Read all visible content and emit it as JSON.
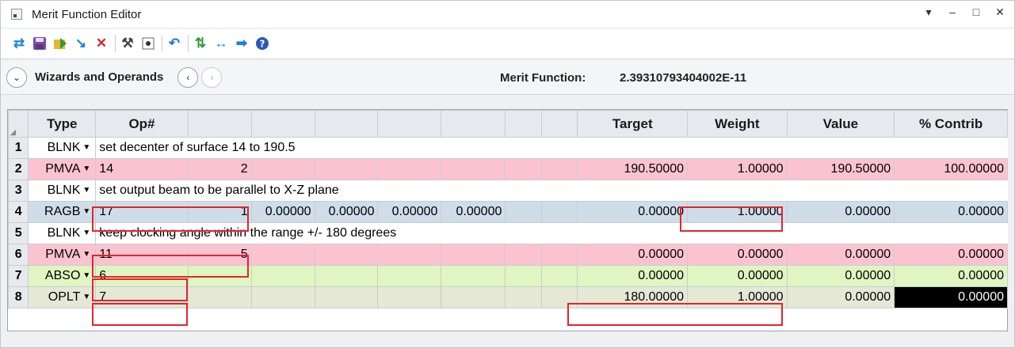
{
  "window": {
    "title": "Merit Function Editor",
    "controls": [
      "▾",
      "–",
      "□",
      "✕"
    ]
  },
  "toolbar": {
    "icons": [
      "refresh-icon",
      "save-icon",
      "load-icon",
      "insert-icon",
      "delete-icon",
      "wizard-icon",
      "options-icon",
      "undo-icon",
      "optimize-icon",
      "scroll-icon",
      "go-icon",
      "help-icon"
    ]
  },
  "wizard": {
    "label": "Wizards and Operands",
    "merit_label": "Merit Function:",
    "merit_value": "2.39310793404002E-11"
  },
  "grid": {
    "columns": [
      "Type",
      "Op#",
      "",
      "",
      "",
      "",
      "",
      "",
      "",
      "Target",
      "Weight",
      "Value",
      "% Contrib"
    ],
    "rows": [
      {
        "num": "1",
        "type": "BLNK",
        "style": "blank",
        "comment": "set decenter of surface 14 to 190.5"
      },
      {
        "num": "2",
        "type": "PMVA",
        "style": "pink",
        "op": "14",
        "int2": "2",
        "p": [
          "",
          "",
          "",
          ""
        ],
        "target": "190.50000",
        "weight": "1.00000",
        "value": "190.50000",
        "contrib": "100.00000"
      },
      {
        "num": "3",
        "type": "BLNK",
        "style": "blank",
        "comment": "set output beam to be parallel to X-Z plane"
      },
      {
        "num": "4",
        "type": "RAGB",
        "style": "blue",
        "op": "17",
        "int2": "1",
        "p": [
          "0.00000",
          "0.00000",
          "0.00000",
          "0.00000"
        ],
        "target": "0.00000",
        "weight": "1.00000",
        "value": "0.00000",
        "contrib": "0.00000"
      },
      {
        "num": "5",
        "type": "BLNK",
        "style": "blank",
        "comment": "keep clocking angle within the range +/- 180 degrees"
      },
      {
        "num": "6",
        "type": "PMVA",
        "style": "pink",
        "op": "11",
        "int2": "5",
        "p": [
          "",
          "",
          "",
          ""
        ],
        "target": "0.00000",
        "weight": "0.00000",
        "value": "0.00000",
        "contrib": "0.00000"
      },
      {
        "num": "7",
        "type": "ABSO",
        "style": "green",
        "op": "6",
        "int2": "",
        "p": [
          "",
          "",
          "",
          ""
        ],
        "target": "0.00000",
        "weight": "0.00000",
        "value": "0.00000",
        "contrib": "0.00000"
      },
      {
        "num": "8",
        "type": "OPLT",
        "style": "beige",
        "op": "7",
        "int2": "",
        "p": [
          "",
          "",
          "",
          ""
        ],
        "target": "180.00000",
        "weight": "1.00000",
        "value": "0.00000",
        "contrib": "0.00000"
      }
    ]
  }
}
